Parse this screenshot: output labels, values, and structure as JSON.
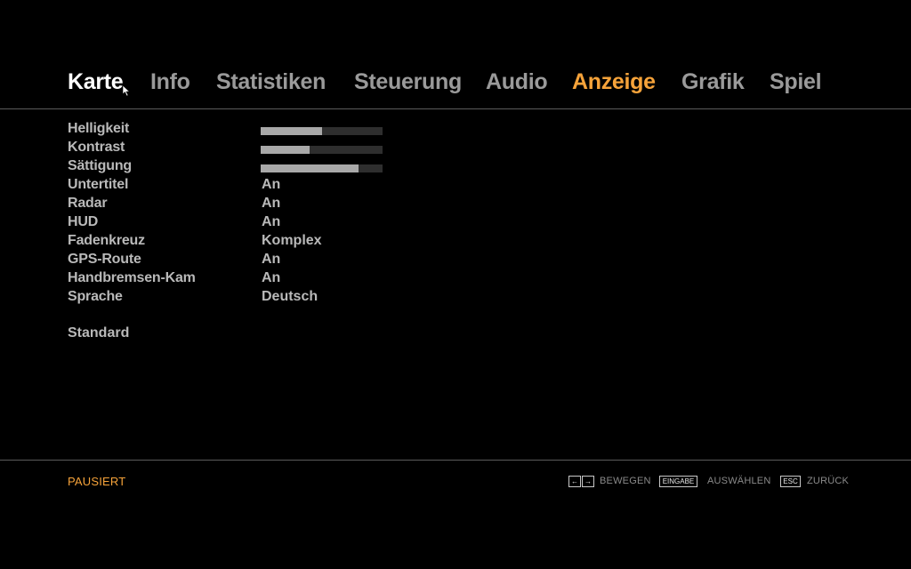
{
  "tabs": [
    {
      "label": "Karte",
      "state": "current"
    },
    {
      "label": "Info",
      "state": "normal"
    },
    {
      "label": "Statistiken",
      "state": "normal"
    },
    {
      "label": "Steuerung",
      "state": "normal"
    },
    {
      "label": "Audio",
      "state": "normal"
    },
    {
      "label": "Anzeige",
      "state": "active"
    },
    {
      "label": "Grafik",
      "state": "normal"
    },
    {
      "label": "Spiel",
      "state": "normal"
    }
  ],
  "settings": [
    {
      "label": "Helligkeit",
      "type": "slider",
      "level": 0.5
    },
    {
      "label": "Kontrast",
      "type": "slider",
      "level": 0.4
    },
    {
      "label": "Sättigung",
      "type": "slider",
      "level": 0.8
    },
    {
      "label": "Untertitel",
      "type": "toggle",
      "value": "An"
    },
    {
      "label": "Radar",
      "type": "toggle",
      "value": "An"
    },
    {
      "label": "HUD",
      "type": "toggle",
      "value": "An"
    },
    {
      "label": "Fadenkreuz",
      "type": "option",
      "value": "Komplex"
    },
    {
      "label": "GPS-Route",
      "type": "toggle",
      "value": "An"
    },
    {
      "label": "Handbremsen-Kam",
      "type": "toggle",
      "value": "An"
    },
    {
      "label": "Sprache",
      "type": "option",
      "value": "Deutsch"
    }
  ],
  "standard_label": "Standard",
  "footer": {
    "status": "PAUSIERT",
    "hints": {
      "move_keys": [
        "←",
        "→"
      ],
      "move_label": "BEWEGEN",
      "select_key": "EINGABE",
      "select_label": "AUSWÄHLEN",
      "back_key": "ESC",
      "back_label": "ZURÜCK"
    }
  },
  "colors": {
    "accent": "#f6a33a",
    "text": "#b9b9b9",
    "tab_inactive": "#9a9a9a",
    "tab_current": "#ffffff",
    "background": "#000000"
  },
  "icons": {
    "cursor": "mouse-pointer-icon"
  }
}
